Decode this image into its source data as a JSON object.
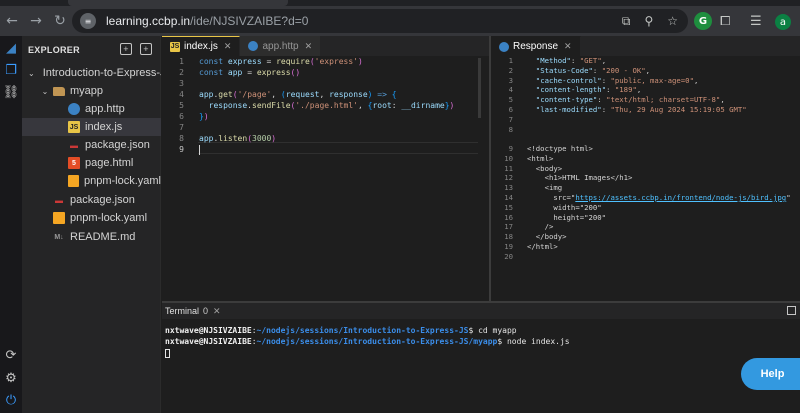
{
  "browser": {
    "url_host": "learning.ccbp.in",
    "url_path": "/ide/NJSIVZAIBE?d=0",
    "avatar_letter": "a",
    "ext_letter": "G"
  },
  "explorer": {
    "title": "EXPLORER",
    "items": [
      {
        "label": "Introduction-to-Express-JS",
        "icon": "folder-icon"
      },
      {
        "label": "myapp",
        "icon": "folder-icon"
      },
      {
        "label": "app.http",
        "icon": "http-file-icon"
      },
      {
        "label": "index.js",
        "icon": "js-file-icon"
      },
      {
        "label": "package.json",
        "icon": "json-file-icon"
      },
      {
        "label": "page.html",
        "icon": "html-file-icon"
      },
      {
        "label": "pnpm-lock.yaml",
        "icon": "yaml-file-icon"
      },
      {
        "label": "package.json",
        "icon": "json-file-icon"
      },
      {
        "label": "pnpm-lock.yaml",
        "icon": "yaml-file-icon"
      },
      {
        "label": "README.md",
        "icon": "markdown-file-icon"
      }
    ]
  },
  "editor": {
    "tabs": [
      {
        "label": "index.js"
      },
      {
        "label": "app.http"
      }
    ],
    "line_numbers": [
      "1",
      "2",
      "3",
      "4",
      "5",
      "6",
      "7",
      "8",
      "9"
    ],
    "code": {
      "l1_kw": "const",
      "l1_var": "express",
      "l1_eq": " = ",
      "l1_fn": "require",
      "l1_str": "'express'",
      "l2_kw": "const",
      "l2_var": "app",
      "l2_eq": " = ",
      "l2_fn": "express",
      "l4_obj": "app",
      "l4_fn": "get",
      "l4_str": "'/page'",
      "l4_p1": "request",
      "l4_p2": "response",
      "l4_arrow": " => ",
      "l5_obj": "response",
      "l5_fn": "sendFile",
      "l5_str": "'./page.html'",
      "l5_key": "root",
      "l5_val": "__dirname",
      "l8_obj": "app",
      "l8_fn": "listen",
      "l8_num": "3000"
    }
  },
  "response": {
    "tab_label": "Response",
    "lines": [
      {
        "n": "1",
        "k": "\"Method\"",
        "v": "\"GET\""
      },
      {
        "n": "2",
        "k": "\"Status-Code\"",
        "v": "\"200 - OK\""
      },
      {
        "n": "3",
        "k": "\"cache-control\"",
        "v": "\"public, max-age=0\""
      },
      {
        "n": "4",
        "k": "\"content-length\"",
        "v": "\"189\""
      },
      {
        "n": "5",
        "k": "\"content-type\"",
        "v": "\"text/html; charset=UTF-8\""
      },
      {
        "n": "6",
        "k": "\"last-modified\"",
        "v": "\"Thu, 29 Aug 2024 15:19:05 GMT\""
      }
    ],
    "blank_numbers": [
      "7",
      "8"
    ],
    "html_lines": [
      {
        "n": "9",
        "t": "<!doctype html>"
      },
      {
        "n": "10",
        "t": "<html>"
      },
      {
        "n": "11",
        "t": "  <body>"
      },
      {
        "n": "12",
        "t": "    <h1>HTML Images</h1>"
      },
      {
        "n": "13",
        "t": "    <img"
      },
      {
        "n": "14",
        "t_prefix": "      src=\"",
        "url": "https://assets.ccbp.in/frontend/node-js/bird.jpg",
        "t_suffix": "\""
      },
      {
        "n": "15",
        "t": "      width=\"200\""
      },
      {
        "n": "16",
        "t": "      height=\"200\""
      },
      {
        "n": "17",
        "t": "    />"
      },
      {
        "n": "18",
        "t": "  </body>"
      },
      {
        "n": "19",
        "t": "</html>"
      },
      {
        "n": "20",
        "t": ""
      }
    ]
  },
  "terminal": {
    "tab_label": "Terminal",
    "count": "0",
    "lines": [
      {
        "user": "nxtwave@NJSIVZAIBE",
        "path": "~/nodejs/sessions/Introduction-to-Express-JS",
        "cmd": "$ cd myapp"
      },
      {
        "user": "nxtwave@NJSIVZAIBE",
        "path": "~/nodejs/sessions/Introduction-to-Express-JS/myapp",
        "cmd": "$ node index.js"
      }
    ]
  },
  "help_label": "Help"
}
